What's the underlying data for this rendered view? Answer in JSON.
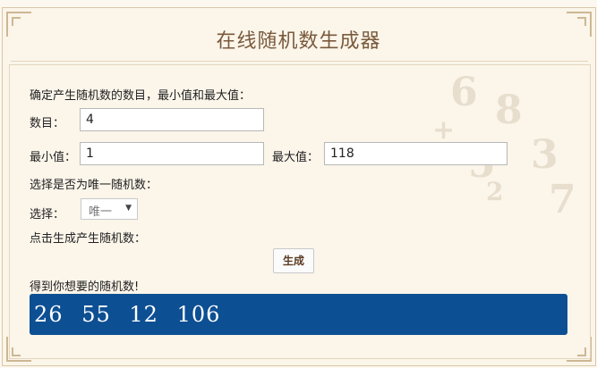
{
  "header": {
    "title": "在线随机数生成器"
  },
  "form": {
    "intro": "确定产生随机数的数目，最小值和最大值：",
    "count_label": "数目：",
    "count_value": "4",
    "min_label": "最小值：",
    "min_value": "1",
    "max_label": "最大值：",
    "max_value": "118",
    "unique_prompt": "选择是否为唯一随机数：",
    "select_label": "选择：",
    "select_value": "唯一",
    "generate_prompt": "点击生成产生随机数：",
    "generate_button": "生成",
    "result_label": "得到你想要的随机数!",
    "results": [
      "26",
      "55",
      "12",
      "106"
    ]
  },
  "colors": {
    "title": "#7a5a3c",
    "result_bg": "#0d4f93",
    "page_bg": "#fdf8ef"
  }
}
